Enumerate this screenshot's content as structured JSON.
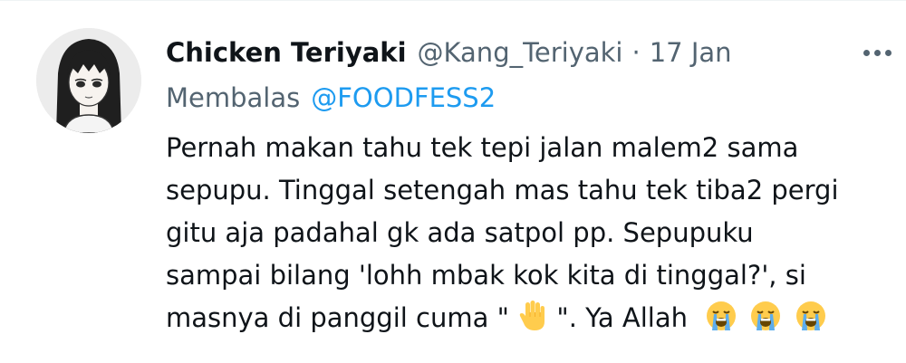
{
  "tweet": {
    "author": {
      "display_name": "Chicken Teriyaki",
      "handle": "@Kang_Teriyaki",
      "avatar_icon": "anime-girl-avatar"
    },
    "separator": "·",
    "timestamp": "17 Jan",
    "more_icon": "more-horizontal-icon",
    "reply": {
      "label": "Membalas",
      "to_handle": "@FOODFESS2"
    },
    "text_lines": [
      "Pernah makan tahu tek tepi jalan malem2 sama",
      "sepupu. Tinggal setengah mas tahu tek tiba2 pergi",
      "gitu aja padahal gk ada satpol pp. Sepupuku",
      "sampai bilang 'lohh mbak kok kita di tinggal?', si"
    ],
    "last_line": {
      "prefix": "masnya di panggil cuma \"",
      "emoji_hand": "raised-hand-emoji",
      "middle": "\". Ya Allah",
      "emoji_crying": [
        "loudly-crying-face-emoji",
        "loudly-crying-face-emoji",
        "loudly-crying-face-emoji"
      ]
    }
  },
  "colors": {
    "text": "#0f1419",
    "secondary": "#536471",
    "link": "#1d9bf0",
    "emoji_yellow": "#ffcc4d",
    "emoji_tears": "#5dadec"
  }
}
